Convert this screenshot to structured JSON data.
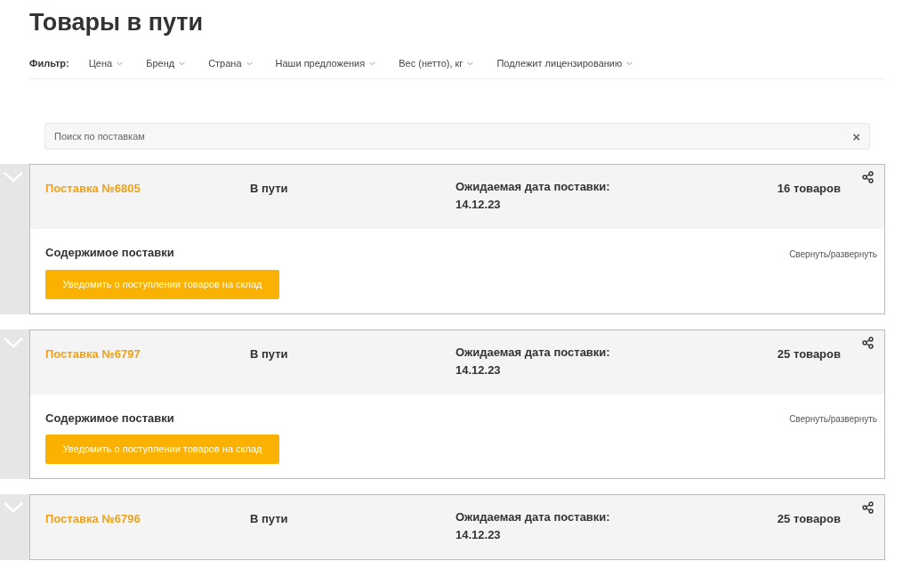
{
  "title": "Товары в пути",
  "filter": {
    "label": "Фильтр:",
    "options": [
      "Цена",
      "Бренд",
      "Страна",
      "Наши предложения",
      "Вес (нетто), кг",
      "Подлежит лицензированию"
    ]
  },
  "search": {
    "placeholder": "Поиск по поставкам",
    "clear": "×"
  },
  "shipments": [
    {
      "number": "Поставка №6805",
      "status": "В пути",
      "date_label": "Ожидаемая дата поставки:",
      "date": "14.12.23",
      "count": "16 товаров",
      "contents_title": "Содержимое поставки",
      "toggle": "Свернуть/развернуть",
      "notify_button": "Уведомить о поступлении товаров на склад"
    },
    {
      "number": "Поставка №6797",
      "status": "В пути",
      "date_label": "Ожидаемая дата поставки:",
      "date": "14.12.23",
      "count": "25 товаров",
      "contents_title": "Содержимое поставки",
      "toggle": "Свернуть/развернуть",
      "notify_button": "Уведомить о поступлении товаров на склад"
    },
    {
      "number": "Поставка №6796",
      "status": "В пути",
      "date_label": "Ожидаемая дата поставки:",
      "date": "14.12.23",
      "count": "25 товаров"
    }
  ]
}
